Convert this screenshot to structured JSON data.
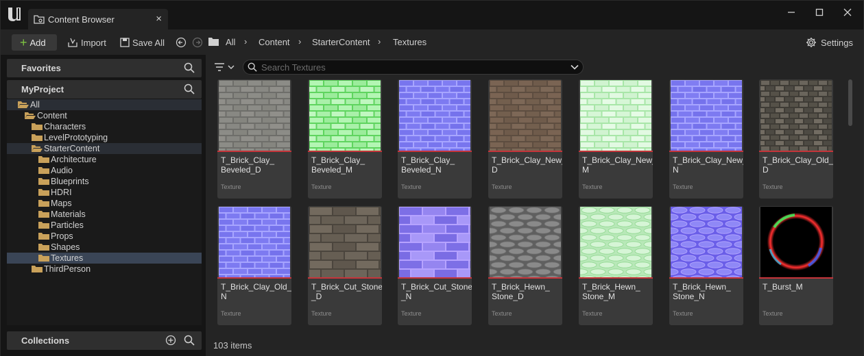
{
  "window": {
    "tab_title": "Content Browser",
    "minimize": "—",
    "maximize": "☐",
    "close": "✕"
  },
  "toolbar": {
    "add_label": "Add",
    "import_label": "Import",
    "save_all_label": "Save All",
    "settings_label": "Settings",
    "breadcrumb": [
      "All",
      "Content",
      "StarterContent",
      "Textures"
    ]
  },
  "left_panel": {
    "favorites_label": "Favorites",
    "project_label": "MyProject",
    "collections_label": "Collections",
    "tree": [
      {
        "label": "All",
        "level": 0,
        "expanded": true
      },
      {
        "label": "Content",
        "level": 1,
        "expanded": true
      },
      {
        "label": "Characters",
        "level": 2,
        "expanded": false
      },
      {
        "label": "LevelPrototyping",
        "level": 2,
        "expanded": false
      },
      {
        "label": "StarterContent",
        "level": 2,
        "expanded": true
      },
      {
        "label": "Architecture",
        "level": 3
      },
      {
        "label": "Audio",
        "level": 3
      },
      {
        "label": "Blueprints",
        "level": 3,
        "expanded": false
      },
      {
        "label": "HDRI",
        "level": 3
      },
      {
        "label": "Maps",
        "level": 3
      },
      {
        "label": "Materials",
        "level": 3
      },
      {
        "label": "Particles",
        "level": 3,
        "expanded": false
      },
      {
        "label": "Props",
        "level": 3,
        "expanded": false
      },
      {
        "label": "Shapes",
        "level": 3
      },
      {
        "label": "Textures",
        "level": 3,
        "selected": true
      },
      {
        "label": "ThirdPerson",
        "level": 2,
        "expanded": false
      }
    ]
  },
  "content": {
    "search_placeholder": "Search Textures",
    "items_count": "103 items",
    "assets": [
      {
        "name": "T_Brick_Clay_\nBeveled_D",
        "type": "Texture",
        "style": "gray-brick"
      },
      {
        "name": "T_Brick_Clay_\nBeveled_M",
        "type": "Texture",
        "style": "green-brick"
      },
      {
        "name": "T_Brick_Clay_\nBeveled_N",
        "type": "Texture",
        "style": "blue-brick"
      },
      {
        "name": "T_Brick_Clay_New_\nD",
        "type": "Texture",
        "style": "brown-brick"
      },
      {
        "name": "T_Brick_Clay_New_\nM",
        "type": "Texture",
        "style": "pale-green-brick"
      },
      {
        "name": "T_Brick_Clay_New_\nN",
        "type": "Texture",
        "style": "blue-brick"
      },
      {
        "name": "T_Brick_Clay_Old_\nD",
        "type": "Texture",
        "style": "old-brick"
      },
      {
        "name": "T_Brick_Clay_Old_\nN",
        "type": "Texture",
        "style": "blue-brick"
      },
      {
        "name": "T_Brick_Cut_Stone\n_D",
        "type": "Texture",
        "style": "cut-stone"
      },
      {
        "name": "T_Brick_Cut_Stone\n_N",
        "type": "Texture",
        "style": "cut-stone-normal"
      },
      {
        "name": "T_Brick_Hewn_\nStone_D",
        "type": "Texture",
        "style": "hewn-gray"
      },
      {
        "name": "T_Brick_Hewn_\nStone_M",
        "type": "Texture",
        "style": "hewn-green"
      },
      {
        "name": "T_Brick_Hewn_\nStone_N",
        "type": "Texture",
        "style": "hewn-blue"
      },
      {
        "name": "T_Burst_M",
        "type": "Texture",
        "style": "burst"
      }
    ]
  },
  "colors": {
    "accent_red": "#c6343a",
    "add_green": "#7ec542",
    "selection": "#3a4556",
    "folder": "#c9a15a"
  }
}
